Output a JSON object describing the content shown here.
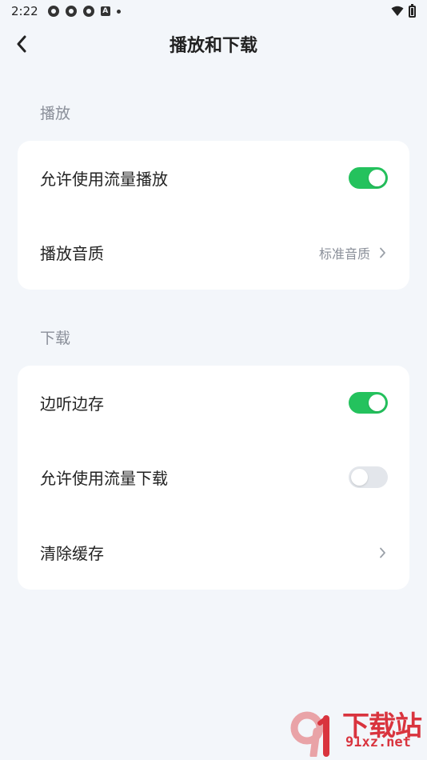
{
  "status_bar": {
    "time": "2:22"
  },
  "header": {
    "title": "播放和下载"
  },
  "sections": {
    "play": {
      "label": "播放",
      "rows": {
        "mobile_data_play": {
          "label": "允许使用流量播放",
          "toggle_on": true
        },
        "audio_quality": {
          "label": "播放音质",
          "value": "标准音质"
        }
      }
    },
    "download": {
      "label": "下载",
      "rows": {
        "cache_while_playing": {
          "label": "边听边存",
          "toggle_on": true
        },
        "mobile_data_download": {
          "label": "允许使用流量下载",
          "toggle_on": false
        },
        "clear_cache": {
          "label": "清除缓存"
        }
      }
    }
  },
  "watermark": {
    "brand": "下载站",
    "url": "91xz.net",
    "logo_text": "91"
  },
  "colors": {
    "toggle_on": "#24c25d",
    "toggle_off": "#e3e6eb",
    "background": "#f3f6fa",
    "watermark": "#d9343e"
  }
}
